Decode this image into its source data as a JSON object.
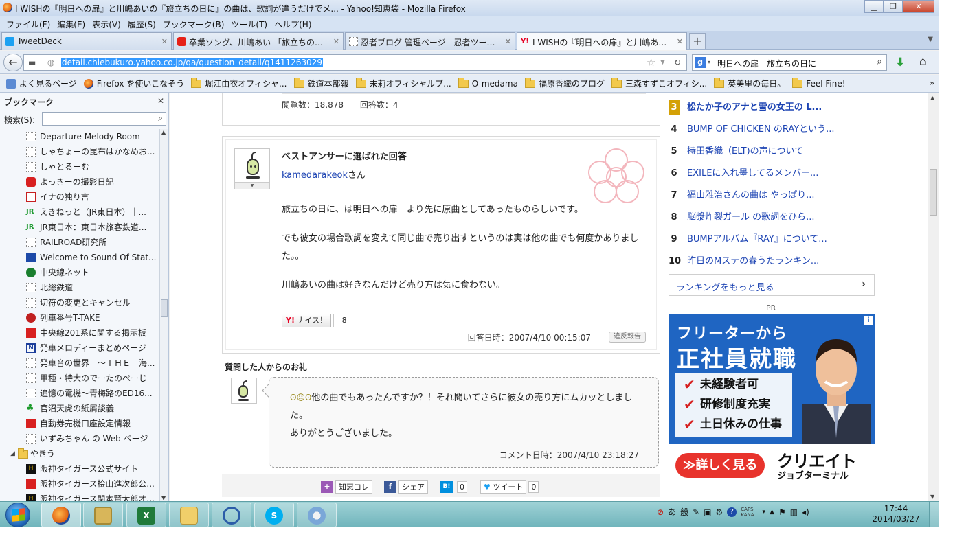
{
  "window": {
    "title": "I WISHの『明日への扉』と川嶋あいの『旅立ちの日に』の曲は、歌詞が違うだけでメ... - Yahoo!知恵袋 - Mozilla Firefox"
  },
  "menubar": [
    "ファイル(F)",
    "編集(E)",
    "表示(V)",
    "履歴(S)",
    "ブックマーク(B)",
    "ツール(T)",
    "ヘルプ(H)"
  ],
  "tabs": [
    {
      "label": "TweetDeck",
      "icon": "tweetdeck-icon"
    },
    {
      "label": "卒業ソング、川嶋あい 「旅立ちの…",
      "icon": "youtube-icon"
    },
    {
      "label": "忍者ブログ 管理ページ - 忍者ツー…",
      "icon": "blank-page-icon"
    },
    {
      "label": "I WISHの『明日への扉』と川嶋あ…",
      "icon": "yahoo-icon",
      "active": true
    }
  ],
  "navbar": {
    "url": "detail.chiebukuro.yahoo.co.jp/qa/question_detail/q1411263029",
    "search_value": "明日への扉　旅立ちの日に"
  },
  "bookmarks_toolbar": [
    {
      "label": "よく見るページ",
      "icon": "most-visited-icon"
    },
    {
      "label": "Firefox を使いこなそう",
      "icon": "firefox-icon"
    },
    {
      "label": "堀江由衣オフィシャ...",
      "icon": "folder-icon"
    },
    {
      "label": "鉄道本部報",
      "icon": "folder-icon"
    },
    {
      "label": "未莉オフィシャルブ...",
      "icon": "folder-icon"
    },
    {
      "label": "O-medama",
      "icon": "folder-icon"
    },
    {
      "label": "福原香織のブログ",
      "icon": "folder-icon"
    },
    {
      "label": "三森すずこオフィシ...",
      "icon": "folder-icon"
    },
    {
      "label": "英美里の毎日。",
      "icon": "folder-icon"
    },
    {
      "label": "Feel Fine!",
      "icon": "folder-icon"
    }
  ],
  "sidebar": {
    "title": "ブックマーク",
    "search_label": "検索(S):",
    "items": [
      {
        "label": "Departure Melody Room",
        "icon": "blank"
      },
      {
        "label": "しゃちょーの昆布はかなめお...",
        "icon": "blank"
      },
      {
        "label": "しゃとるーむ",
        "icon": "blank"
      },
      {
        "label": "よっきーの撮影日記",
        "icon": "red"
      },
      {
        "label": "イナの独り言",
        "icon": "red"
      },
      {
        "label": "えきねっと（JR東日本）｜...",
        "icon": "jr"
      },
      {
        "label": "JR東日本：東日本旅客鉄道...",
        "icon": "jr"
      },
      {
        "label": "RAILROAD研究所",
        "icon": "blank"
      },
      {
        "label": "Welcome to Sound Of Stat...",
        "icon": "blue"
      },
      {
        "label": "中央線ネット",
        "icon": "green"
      },
      {
        "label": "北総鉄道",
        "icon": "blank"
      },
      {
        "label": "切符の変更とキャンセル",
        "icon": "blank"
      },
      {
        "label": "列車番号T-TAKE",
        "icon": "red"
      },
      {
        "label": "中央線201系に関する掲示板",
        "icon": "red"
      },
      {
        "label": "発車メロディーまとめページ",
        "icon": "navy"
      },
      {
        "label": "発車音の世界　～ＴＨＥ　海...",
        "icon": "blank"
      },
      {
        "label": "甲種・特大のでーたのぺーじ",
        "icon": "blank"
      },
      {
        "label": "追憶の電機～青梅路のED16...",
        "icon": "blank"
      },
      {
        "label": "官沼天虎の紙屑談義",
        "icon": "flower"
      },
      {
        "label": "自動券売機口座設定情報",
        "icon": "red"
      },
      {
        "label": "いずみちゃん の Web ページ",
        "icon": "blank"
      }
    ],
    "folder": {
      "label": "やきう"
    },
    "folder_items": [
      {
        "label": "阪神タイガース公式サイト",
        "icon": "tiger"
      },
      {
        "label": "阪神タイガース桧山進次郎公...",
        "icon": "red"
      },
      {
        "label": "阪神タイガース関本賢太郎オ...",
        "icon": "tiger"
      }
    ]
  },
  "question": {
    "views_label": "閲覧数：18,878",
    "answers_label": "回答数：4"
  },
  "best_answer": {
    "heading": "ベストアンサーに選ばれた回答",
    "username": "kamedarakeok",
    "honorific": "さん",
    "paragraphs": [
      "旅立ちの日に、は明日への扉　より先に原曲としてあったものらしいです。",
      "でも彼女の場合歌詞を変えて同じ曲で売り出すというのは実は他の曲でも何度かありました。。",
      "川嶋あいの曲は好きなんだけど売り方は気に食わない。"
    ],
    "naisu_label": "ナイス！",
    "naisu_count": "8",
    "date": "回答日時：2007/4/10 00:15:07",
    "report_label": "違反報告"
  },
  "thanks": {
    "heading": "質問した人からのお礼",
    "line1": "他の曲でもあったんですか？！それ聞いてさらに彼女の売り方にムカッとしました。",
    "line2": "ありがとうございました。",
    "date": "コメント日時：2007/4/10 23:18:27"
  },
  "share": {
    "chiekore": "知恵コレ",
    "facebook": "シェア",
    "hatena_count": "0",
    "tweet": "ツイート",
    "tweet_count": "0"
  },
  "ranking": {
    "items": [
      {
        "num": "3",
        "text": "松たか子のアナと雪の女王の L..."
      },
      {
        "num": "4",
        "text": "BUMP OF CHICKEN のRAYという..."
      },
      {
        "num": "5",
        "text": "持田香織（ELT)の声について"
      },
      {
        "num": "6",
        "text": "EXILEに入れ墨してるメンバー..."
      },
      {
        "num": "7",
        "text": "福山雅治さんの曲は やっぱり..."
      },
      {
        "num": "8",
        "text": "脳漿炸裂ガール の歌詞をひら..."
      },
      {
        "num": "9",
        "text": "BUMPアルバム『RAY』について..."
      },
      {
        "num": "10",
        "text": "昨日のMステの春うたランキン..."
      }
    ],
    "more_label": "ランキングをもっと見る"
  },
  "ad": {
    "pr_label": "PR",
    "headline1": "フリーターから",
    "headline2": "正社員就職",
    "checks": [
      "未経験者可",
      "研修制度充実",
      "土日休みの仕事"
    ],
    "cta": "≫詳しく見る",
    "logo": "クリエイト",
    "logo_sub": "ジョブターミナル"
  },
  "taskbar": {
    "time": "17:44",
    "date": "2014/03/27",
    "ime_a": "あ",
    "ime_mode": "般",
    "caps_label": "CAPS",
    "kana_label": "KANA"
  },
  "colors": {
    "link": "#1d44b3",
    "accent_red": "#e60023",
    "ad_blue": "#1f65c2",
    "gold_rank": "#d4a106"
  }
}
